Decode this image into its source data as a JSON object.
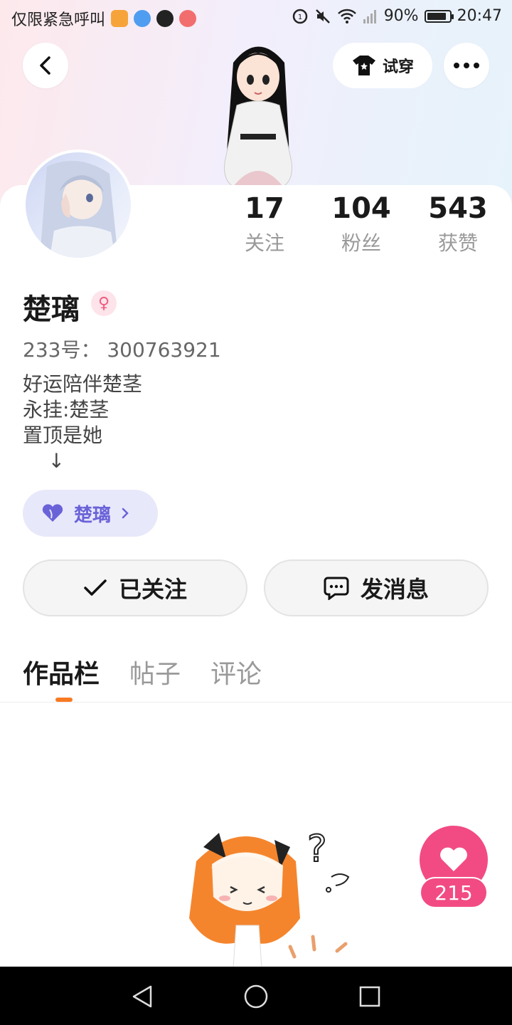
{
  "status_bar": {
    "carrier_text": "仅限紧急呼叫",
    "app_icons": [
      "video-app-icon",
      "browser-app-icon",
      "tiktok-icon",
      "bilibili-icon"
    ],
    "battery": "90%",
    "battery_level": 0.9,
    "time": "20:47"
  },
  "header": {
    "back_icon": "chevron-left-icon",
    "try_on_label": "试穿",
    "more_icon": "more-dots-icon"
  },
  "profile": {
    "name": "楚璃",
    "gender_icon": "female-icon",
    "uid": "233号：  300763921",
    "bio": "好运陪伴楚茎\n永挂:楚茎\n置顶是她\n    ↓",
    "fan_tag_label": "楚璃"
  },
  "stats": [
    {
      "num": "17",
      "label": "关注"
    },
    {
      "num": "104",
      "label": "粉丝"
    },
    {
      "num": "543",
      "label": "获赞"
    }
  ],
  "actions": {
    "follow_label": "已关注",
    "message_label": "发消息"
  },
  "tabs": [
    "作品栏",
    "帖子",
    "评论"
  ],
  "like_fab": {
    "count": "215"
  },
  "colors": {
    "accent_pink": "#f24b83",
    "tab_underline": "#f77a22",
    "fan_tag_bg": "#e8e8fb",
    "fan_tag_text": "#6a63d8"
  }
}
